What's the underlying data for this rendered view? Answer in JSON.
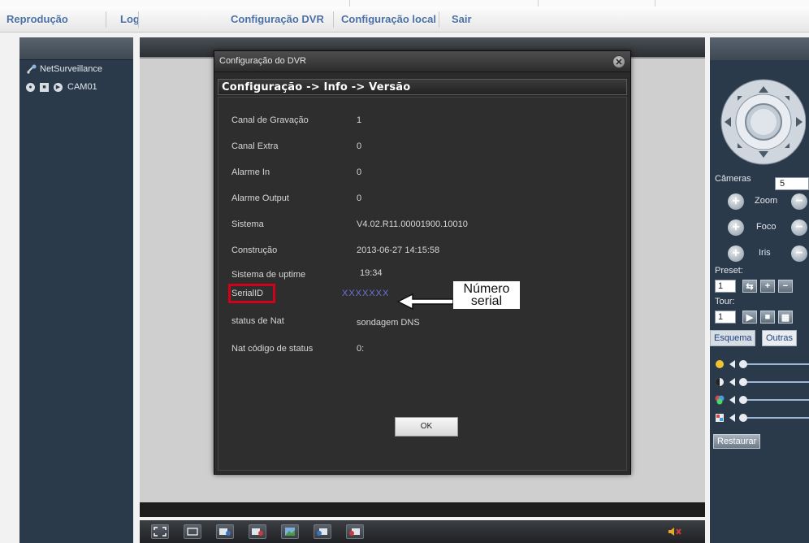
{
  "menu": {
    "items": [
      "Reprodução",
      "Log",
      "Configuração DVR",
      "Configuração local",
      "Sair"
    ]
  },
  "left_panel": {
    "root_label": "NetSurveillance",
    "camera_label": "CAM01"
  },
  "dialog": {
    "title": "Configuração do DVR",
    "breadcrumb": "Configuração -> Info -> Versão",
    "rows": [
      {
        "label": "Canal de Gravação",
        "value": "1"
      },
      {
        "label": "Canal Extra",
        "value": "0"
      },
      {
        "label": "Alarme In",
        "value": "0"
      },
      {
        "label": "Alarme Output",
        "value": "0"
      },
      {
        "label": "Sistema",
        "value": "V4.02.R11.00001900.10010"
      },
      {
        "label": "Construção",
        "value": "2013-06-27 14:15:58"
      },
      {
        "label": "Sistema de uptime",
        "value": "19:34"
      },
      {
        "label": "SerialID",
        "value": "XXXXXXX"
      },
      {
        "label": "status de Nat",
        "value": "sondagem DNS"
      },
      {
        "label": "Nat código de status",
        "value": "0:"
      }
    ],
    "ok_label": "OK"
  },
  "annotation": {
    "line1": "Número",
    "line2": "serial"
  },
  "right_panel": {
    "cameras_label": "Câmeras",
    "cameras_value": "5",
    "zoom_label": "Zoom",
    "focus_label": "Foco",
    "iris_label": "Iris",
    "preset_label": "Preset:",
    "preset_value": "1",
    "tour_label": "Tour:",
    "tour_value": "1",
    "tab_scheme": "Esquema",
    "tab_others": "Outras",
    "restore_label": "Restaurar"
  },
  "colors": {
    "menu_text": "#4a6fa5",
    "panel_bg": "#2b3a4a",
    "dialog_bg": "#2e2e2e",
    "serial_highlight": "#d0021b",
    "serial_value": "#6b74d6"
  }
}
